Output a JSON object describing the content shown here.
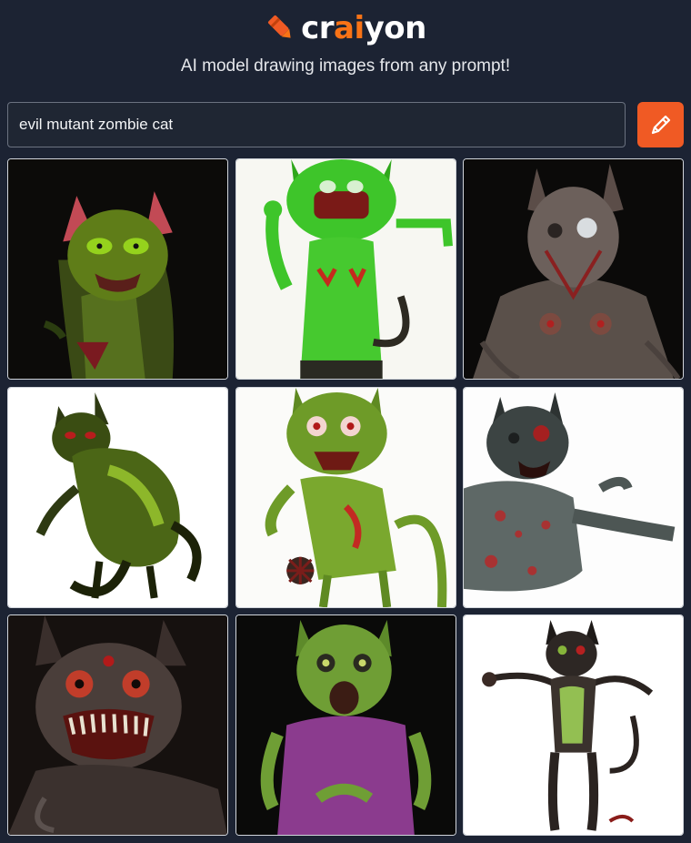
{
  "brand": {
    "logo_prefix": "cr",
    "logo_accent": "ai",
    "logo_suffix": "yon",
    "accent_color": "#f97316",
    "icon": "crayon-pencil-icon"
  },
  "tagline": "AI model drawing images from any prompt!",
  "search": {
    "value": "evil mutant zombie cat",
    "placeholder": ""
  },
  "draw_button": {
    "icon": "pencil-icon",
    "color": "#f05a24"
  },
  "results": [
    {
      "id": "result-1",
      "background": "dark",
      "subject": "green zombie cat with red ears"
    },
    {
      "id": "result-2",
      "background": "white",
      "subject": "bright green cartoon zombie cat"
    },
    {
      "id": "result-3",
      "background": "dark",
      "subject": "grey stitched mutant cat"
    },
    {
      "id": "result-4",
      "background": "white",
      "subject": "dark green crouching cat"
    },
    {
      "id": "result-5",
      "background": "white",
      "subject": "green cat with red eyes"
    },
    {
      "id": "result-6",
      "background": "white",
      "subject": "grey bloody cat torso"
    },
    {
      "id": "result-7",
      "background": "dark",
      "subject": "red eyed fanged cat"
    },
    {
      "id": "result-8",
      "background": "dark",
      "subject": "green cat in purple shirt"
    },
    {
      "id": "result-9",
      "background": "white",
      "subject": "standing dark cat with green chest"
    }
  ]
}
